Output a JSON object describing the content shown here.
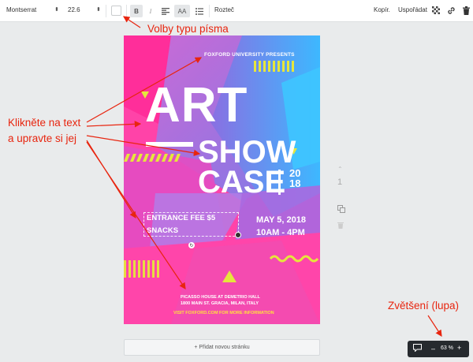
{
  "toolbar": {
    "font_family": "Montserrat",
    "font_size": "22.6",
    "bold_label": "B",
    "italic_label": "I",
    "case_label": "AA",
    "spacing_label": "Rozteč",
    "copy_label": "Kopír.",
    "arrange_label": "Uspořádat"
  },
  "poster": {
    "university": "FOXFORD UNIVERSITY PRESENTS",
    "title_art": "ART",
    "title_show": "SHOW",
    "title_case": "CASE",
    "year_top": "20",
    "year_bottom": "18",
    "entrance": "ENTRANCE FEE $5",
    "snacks": "SNACKS",
    "date": "MAY 5, 2018",
    "time": "10AM - 4PM",
    "venue_line1": "PICASSO HOUSE AT  DEMETRIO HALL",
    "venue_line2": "1800 MAIN ST. GRACIA, MILAN, ITALY",
    "visit": "VISIT FOXFORD.COM FOR MORE INFORMATION"
  },
  "rail": {
    "page_number": "1"
  },
  "add_page_label": "+ Přidat novou stránku",
  "zoom": {
    "level": "63 %",
    "minus": "–",
    "plus": "+"
  },
  "annotations": {
    "font_options": "Volby typu písma",
    "click_text_line1": "Klikněte na text",
    "click_text_line2": "a upravte si jej",
    "zoom": "Zvětšení (lupa)"
  },
  "colors": {
    "annotation": "#e8250f",
    "poster_pink": "#ff3fa5",
    "poster_purple": "#9b6fe0",
    "poster_blue": "#3cb8ff",
    "poster_yellow": "#e6e63c"
  }
}
